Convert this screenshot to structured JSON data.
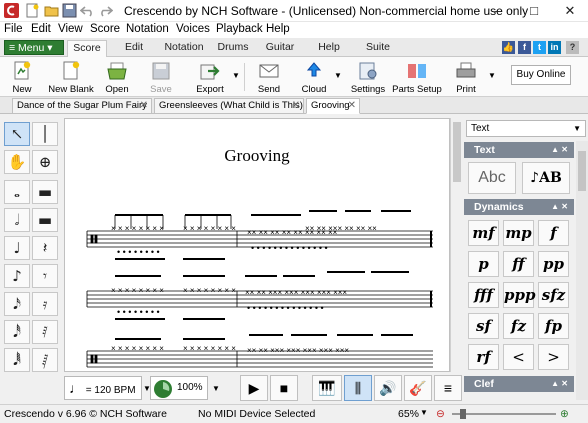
{
  "window": {
    "title": "Crescendo by NCH Software - (Unlicensed) Non-commercial home use only",
    "controls": [
      "–",
      "□",
      "✕"
    ]
  },
  "menubar": [
    "File",
    "Edit",
    "View",
    "Score",
    "Notation",
    "Voices",
    "Playback",
    "Help"
  ],
  "ribbon": {
    "menu_label": "Menu",
    "tabs": [
      "Score",
      "Edit",
      "Notation",
      "Drums",
      "Guitar",
      "Help",
      "Suite"
    ],
    "active_tab": "Score"
  },
  "toolbar": {
    "buttons": [
      "New",
      "New Blank",
      "Open",
      "Save",
      "Export",
      "Send",
      "Cloud",
      "Settings",
      "Parts Setup",
      "Print"
    ],
    "buy_label": "Buy Online"
  },
  "doc_tabs": [
    {
      "label": "Dance of the Sugar Plum Fairy",
      "close": "✕"
    },
    {
      "label": "Greensleeves (What Child is This)",
      "close": "✕"
    },
    {
      "label": "Grooving",
      "close": "✕"
    }
  ],
  "active_doc": "Grooving",
  "score": {
    "title": "Grooving"
  },
  "right_panel": {
    "dropdown_value": "Text",
    "sections": {
      "text": "Text",
      "dynamics": "Dynamics",
      "clef": "Clef"
    },
    "dynamics": [
      "mf",
      "mp",
      "f",
      "p",
      "ff",
      "pp",
      "fff",
      "ppp",
      "sfz",
      "sf",
      "fz",
      "fp",
      "rf",
      "<",
      ">"
    ]
  },
  "bottom_bar": {
    "tempo": "= 120 BPM",
    "speed": "100%"
  },
  "status": {
    "version": "Crescendo v 6.96 © NCH Software",
    "midi": "No MIDI Device Selected",
    "zoom": "65%"
  },
  "colors": {
    "menu_green": "#2e7d32",
    "panel_header": "#7d8794",
    "selection": "#cfe3f7"
  }
}
